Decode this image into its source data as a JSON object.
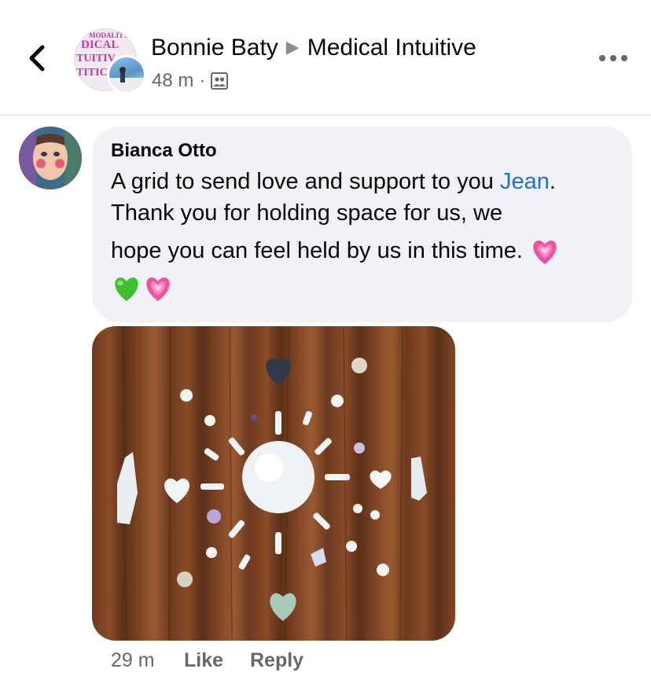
{
  "header": {
    "group_avatar_text": [
      "MODALITY",
      "DICAL",
      "TUITIV",
      "TITIC"
    ],
    "author": "Bonnie Baty",
    "group": "Medical Intuitive",
    "time": "48 m",
    "separator": "·",
    "audience_icon": "group-audience-icon"
  },
  "comment": {
    "author": "Bianca Otto",
    "text_before": "A grid to send love and support to you ",
    "mention": "Jean",
    "text_after_mention": ".",
    "line2": "Thank you for holding space for us, we",
    "line3": "hope you can feel held by us in this time.",
    "emojis": [
      "growing-heart",
      "green-heart",
      "growing-heart"
    ],
    "photo": "crystal-grid-photo",
    "time": "29 m",
    "like_label": "Like",
    "reply_label": "Reply"
  },
  "colors": {
    "mention": "#216fdb",
    "bubble": "#f0f2f5",
    "secondary_text": "#65676b",
    "pink_heart": "#f0509f",
    "green_heart": "#3fbf2e"
  }
}
